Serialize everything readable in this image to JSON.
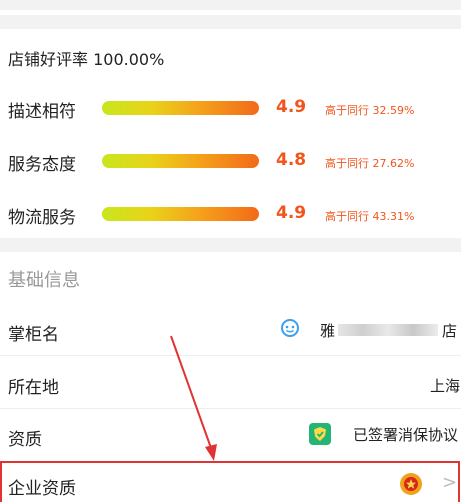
{
  "store_rating": {
    "title": "店铺好评率 100.00%",
    "rows": [
      {
        "label": "描述相符",
        "score": "4.9",
        "compare": "高于同行 32.59%",
        "level": 0.98
      },
      {
        "label": "服务态度",
        "score": "4.8",
        "compare": "高于同行 27.62%",
        "level": 0.96
      },
      {
        "label": "物流服务",
        "score": "4.9",
        "compare": "高于同行 43.31%",
        "level": 0.98
      }
    ]
  },
  "basic_info": {
    "title": "基础信息",
    "shopkeeper": {
      "label": "掌柜名",
      "value_prefix": "雅",
      "value_suffix": "店",
      "icon": "chat-bubble-icon"
    },
    "location": {
      "label": "所在地",
      "value": "上海"
    },
    "qualification": {
      "label": "资质",
      "value": "已签署消保协议",
      "icon": "shield-badge-icon"
    },
    "enterprise": {
      "label": "企业资质",
      "icon": "police-emblem-icon",
      "chevron": ">"
    }
  },
  "colors": {
    "accent": "#f2551c",
    "annotation": "#e03333",
    "section_gray": "#999999"
  }
}
